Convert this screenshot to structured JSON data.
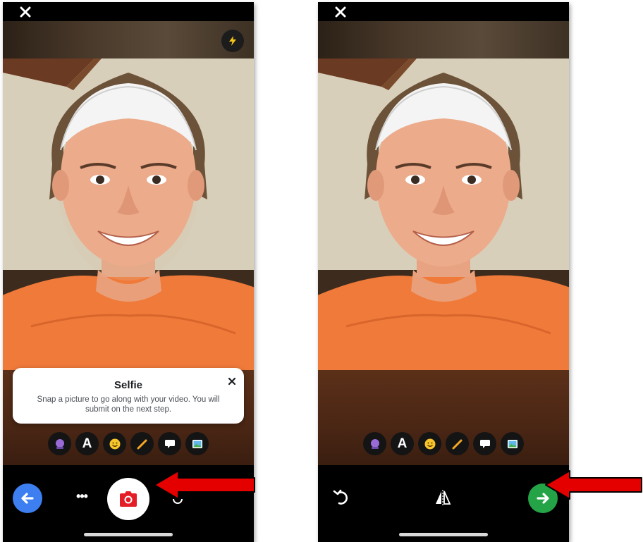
{
  "left_screen": {
    "tooltip": {
      "title": "Selfie",
      "body": "Snap a picture to go along with your video. You will submit on the next step."
    },
    "toolbar_icons": [
      "sticker-effect-icon",
      "text-icon",
      "emoji-icon",
      "draw-icon",
      "speech-bubble-icon",
      "image-icon"
    ],
    "text_tool_label": "A",
    "more_label": "•••"
  },
  "right_screen": {
    "toolbar_icons": [
      "sticker-effect-icon",
      "text-icon",
      "emoji-icon",
      "draw-icon",
      "speech-bubble-icon",
      "image-icon"
    ],
    "text_tool_label": "A"
  },
  "colors": {
    "back_button": "#3d7ff0",
    "shutter_icon": "#e41e26",
    "next_button": "#24a446",
    "flash_icon": "#f5c518",
    "annotation_arrow": "#e50000",
    "shirt": "#f07a3a"
  }
}
